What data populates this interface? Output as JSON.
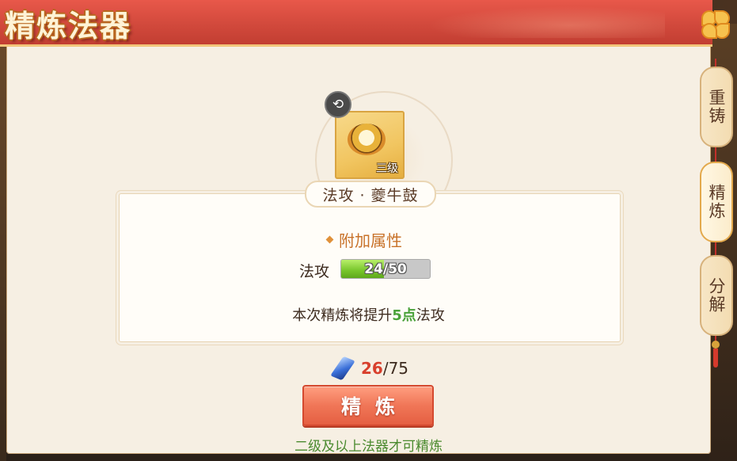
{
  "window": {
    "title": "精炼法器",
    "close_icon": "flower-close-icon"
  },
  "item": {
    "name": "法攻 · 夔牛鼓",
    "level_badge": "三级",
    "icon": "drum-icon",
    "swap_icon": "swap-arrows-icon"
  },
  "attributes": {
    "section_title": "附加属性",
    "stats": [
      {
        "label": "法攻",
        "progress_text": "24/50",
        "current": 24,
        "max": 50
      }
    ]
  },
  "refine": {
    "desc_prefix": "本次精炼将提升",
    "desc_value": "5点",
    "desc_suffix": "法攻",
    "cost_current": "26",
    "cost_total": "/75",
    "cost_icon": "blue-crystal-icon",
    "button_label": "精炼",
    "hint": "二级及以上法器才可精炼"
  },
  "side_tabs": [
    {
      "label": "重铸",
      "active": false
    },
    {
      "label": "精炼",
      "active": true
    },
    {
      "label": "分解",
      "active": false
    }
  ],
  "colors": {
    "header_red": "#d0483b",
    "panel_bg": "#f6efe3",
    "accent_orange": "#c8722a",
    "progress_green": "#77c52b",
    "highlight_green": "#4aa23a",
    "cost_red": "#d8402d",
    "button_red": "#f07657"
  }
}
